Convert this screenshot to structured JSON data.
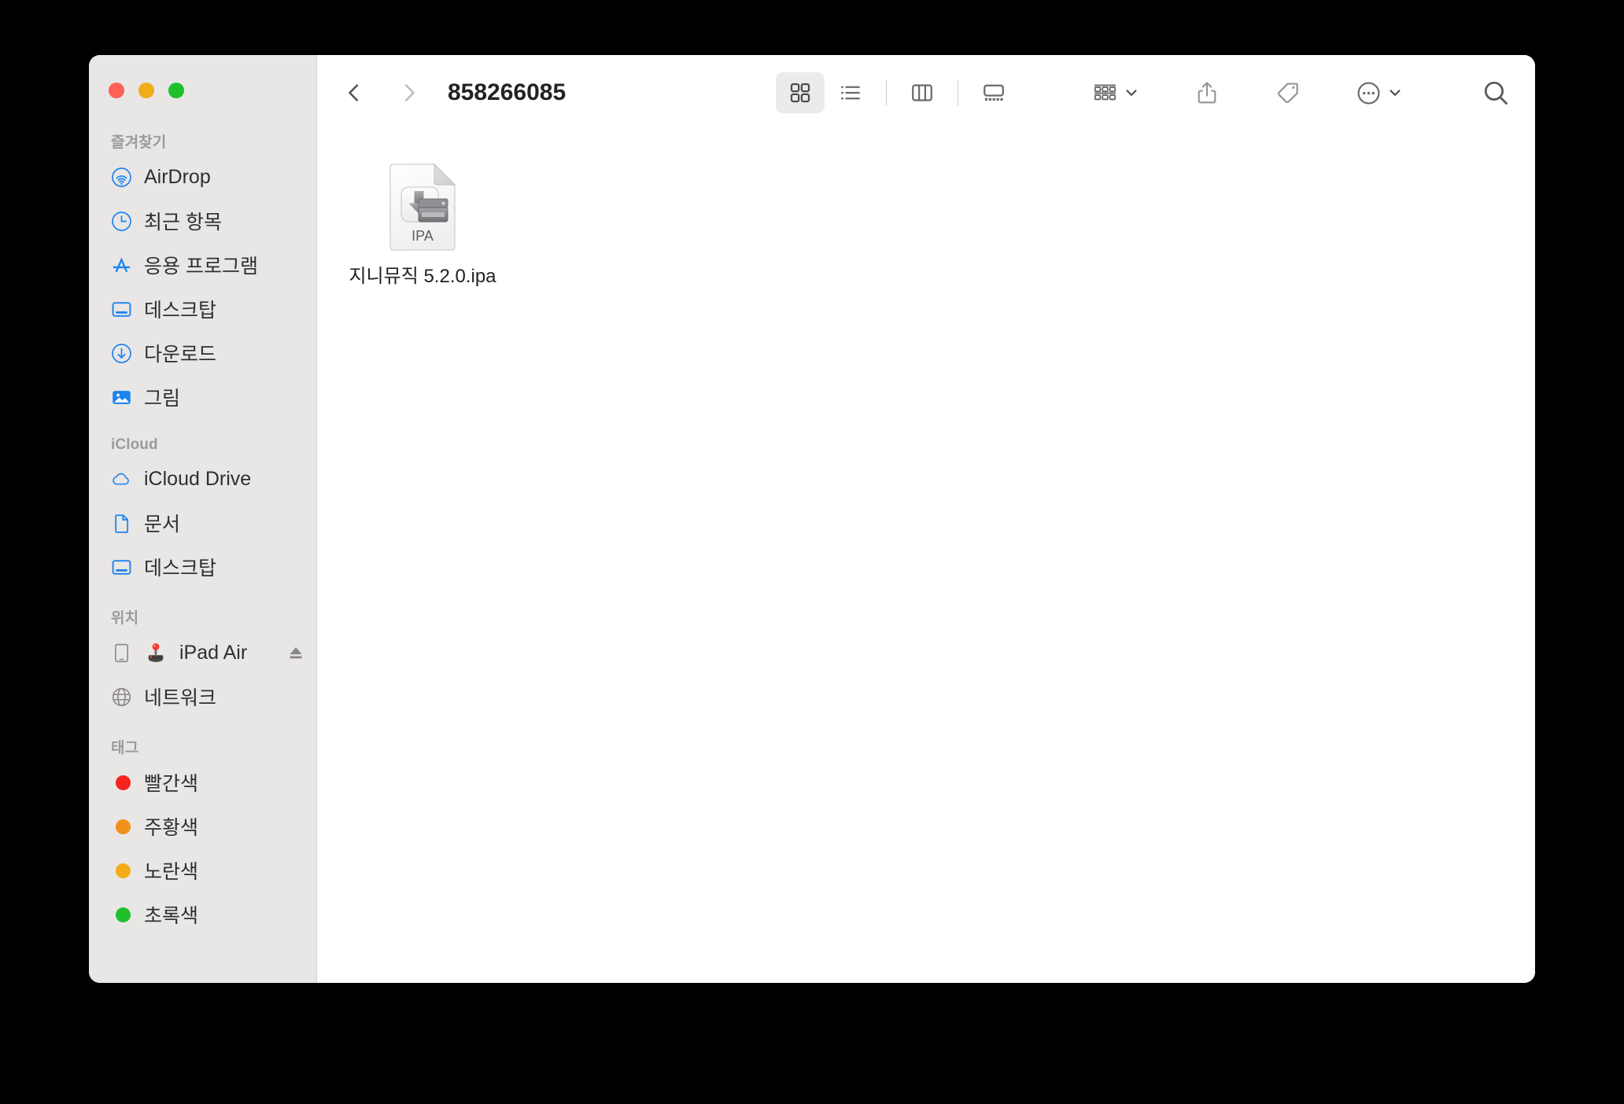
{
  "window": {
    "title": "858266085",
    "traffic_lights": [
      {
        "name": "close",
        "color": "#ff5f57"
      },
      {
        "name": "minimize",
        "color": "#f0ad1a"
      },
      {
        "name": "maximize",
        "color": "#1ec02c"
      }
    ]
  },
  "toolbar": {
    "back_icon": "chevron-left-icon",
    "forward_icon": "chevron-right-icon",
    "view_modes": [
      {
        "id": "icon",
        "icon": "grid-view-icon",
        "selected": true
      },
      {
        "id": "list",
        "icon": "list-view-icon",
        "selected": false
      },
      {
        "id": "column",
        "icon": "column-view-icon",
        "selected": false
      },
      {
        "id": "gallery",
        "icon": "gallery-view-icon",
        "selected": false
      }
    ],
    "actions": [
      {
        "id": "group-by",
        "icon": "group-by-icon",
        "has_chevron": true
      },
      {
        "id": "share",
        "icon": "share-icon",
        "has_chevron": false
      },
      {
        "id": "tag",
        "icon": "tag-icon",
        "has_chevron": false
      },
      {
        "id": "more",
        "icon": "more-ellipsis-icon",
        "has_chevron": true
      }
    ],
    "search_icon": "search-icon"
  },
  "sidebar": {
    "sections": [
      {
        "title": "즐겨찾기",
        "items": [
          {
            "label": "AirDrop",
            "icon": "airdrop-icon",
            "color": "#1a84f0"
          },
          {
            "label": "최근 항목",
            "icon": "clock-icon",
            "color": "#1a84f0"
          },
          {
            "label": "응용 프로그램",
            "icon": "appstore-a-icon",
            "color": "#1a84f0"
          },
          {
            "label": "데스크탑",
            "icon": "desktop-icon",
            "color": "#1a84f0"
          },
          {
            "label": "다운로드",
            "icon": "download-icon",
            "color": "#1a84f0"
          },
          {
            "label": "그림",
            "icon": "pictures-icon",
            "color": "#1a84f0"
          }
        ]
      },
      {
        "title": "iCloud",
        "items": [
          {
            "label": "iCloud Drive",
            "icon": "cloud-icon",
            "color": "#1a84f0"
          },
          {
            "label": "문서",
            "icon": "document-icon",
            "color": "#1a84f0"
          },
          {
            "label": "데스크탑",
            "icon": "desktop-icon",
            "color": "#1a84f0"
          }
        ]
      },
      {
        "title": "위치",
        "items": [
          {
            "label": "iPad Air",
            "icon": "ipad-icon",
            "color": "#8a8787",
            "badge_icon": "joystick-icon",
            "eject_icon": "eject-icon"
          },
          {
            "label": "네트워크",
            "icon": "globe-icon",
            "color": "#8a8787"
          }
        ]
      },
      {
        "title": "태그",
        "items": [
          {
            "label": "빨간색",
            "icon": "tag-dot-icon",
            "color": "#f5241f"
          },
          {
            "label": "주황색",
            "icon": "tag-dot-icon",
            "color": "#f0901a"
          },
          {
            "label": "노란색",
            "icon": "tag-dot-icon",
            "color": "#f5ad17"
          },
          {
            "label": "초록색",
            "icon": "tag-dot-icon",
            "color": "#1ec02c"
          }
        ]
      }
    ]
  },
  "content": {
    "files": [
      {
        "name": "지니뮤직 5.2.0.ipa",
        "type_label": "IPA",
        "icon": "ipa-file-icon"
      }
    ]
  }
}
